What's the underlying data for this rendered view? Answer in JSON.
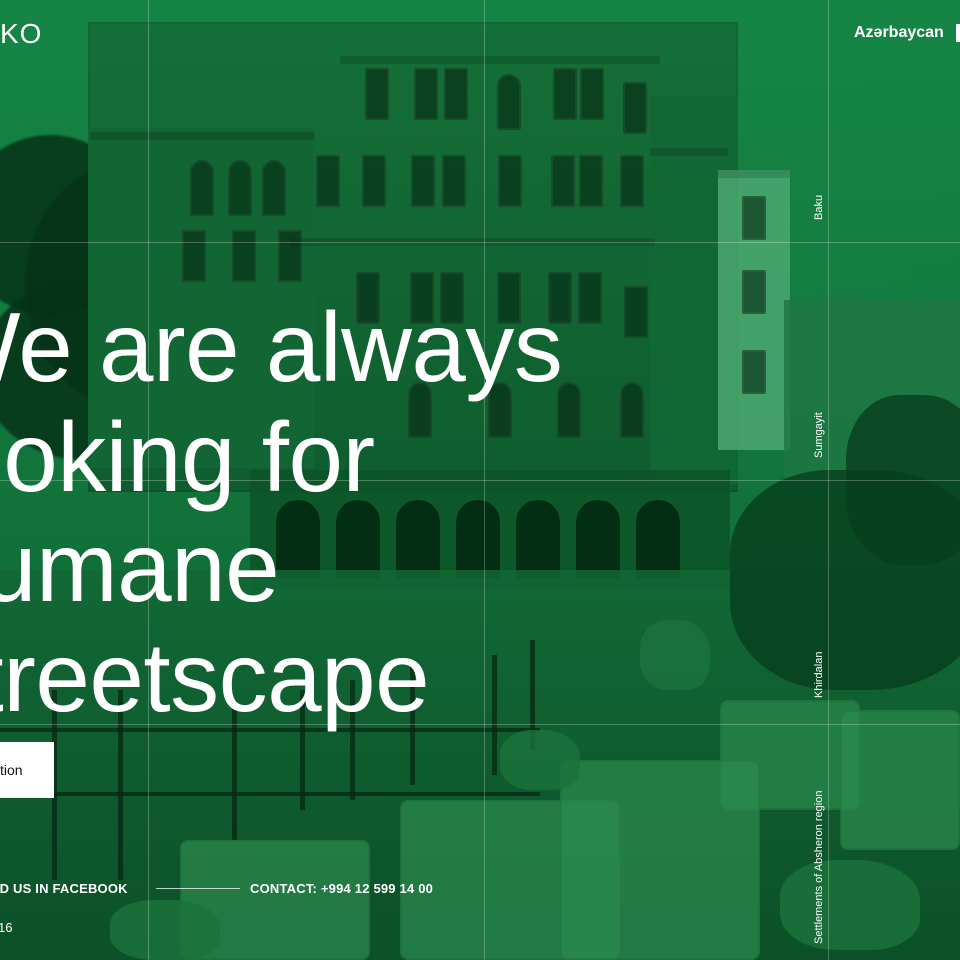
{
  "brand": {
    "logo_text": "KO"
  },
  "header": {
    "language": "Azərbaycan"
  },
  "hero": {
    "headline_lines": [
      "We are always",
      "looking for",
      "humane",
      "streetscape"
    ],
    "cta_label": "tion"
  },
  "footer": {
    "facebook": "ND US IN FACEBOOK",
    "contact": "CONTACT: +994 12 599 14 00",
    "year": "16"
  },
  "side_nav": {
    "items": [
      "Baku",
      "Sumgayit",
      "Khirdalan",
      "Settlements of Absheron region"
    ]
  },
  "theme": {
    "primary_green": "#137a3e",
    "text_color": "#ffffff",
    "button_bg": "#ffffff",
    "button_text": "#111111"
  },
  "icons": {
    "top_right_partial": "menu-icon"
  }
}
